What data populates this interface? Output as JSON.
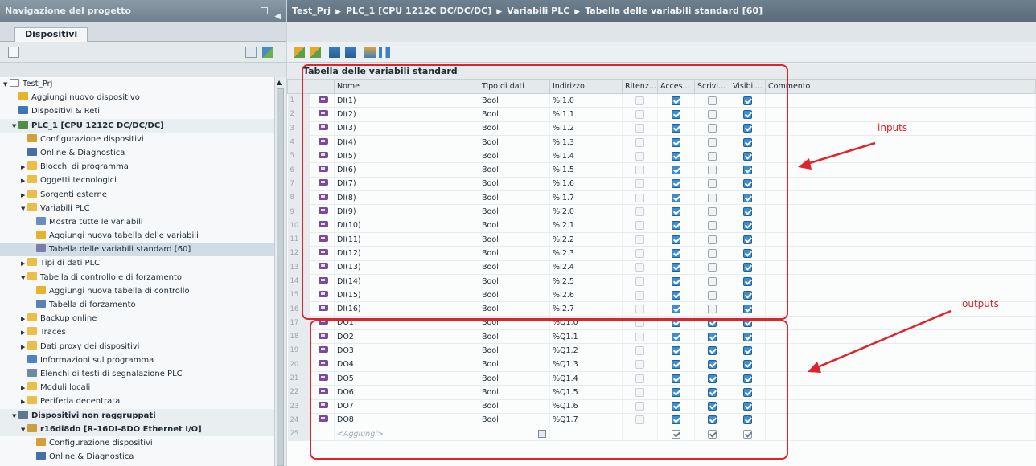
{
  "left_panel": {
    "title": "Navigazione del progetto",
    "tab": "Dispositivi",
    "tree": [
      {
        "label": "Test_Prj",
        "level": 0,
        "expand": "open",
        "icon": "project-icon"
      },
      {
        "label": "Aggiungi nuovo dispositivo",
        "level": 1,
        "expand": "none",
        "icon": "add-device-icon"
      },
      {
        "label": "Dispositivi & Reti",
        "level": 1,
        "expand": "none",
        "icon": "network-icon"
      },
      {
        "label": "PLC_1 [CPU 1212C DC/DC/DC]",
        "level": 1,
        "expand": "open",
        "icon": "plc-icon",
        "bold": true,
        "group": true
      },
      {
        "label": "Configurazione dispositivi",
        "level": 2,
        "expand": "none",
        "icon": "device-config-icon"
      },
      {
        "label": "Online & Diagnostica",
        "level": 2,
        "expand": "none",
        "icon": "diagnostics-icon"
      },
      {
        "label": "Blocchi di programma",
        "level": 2,
        "expand": "closed",
        "icon": "folder-icon"
      },
      {
        "label": "Oggetti tecnologici",
        "level": 2,
        "expand": "closed",
        "icon": "folder-icon"
      },
      {
        "label": "Sorgenti esterne",
        "level": 2,
        "expand": "closed",
        "icon": "folder-icon"
      },
      {
        "label": "Variabili PLC",
        "level": 2,
        "expand": "open",
        "icon": "folder-icon"
      },
      {
        "label": "Mostra tutte le variabili",
        "level": 3,
        "expand": "none",
        "icon": "tags-icon"
      },
      {
        "label": "Aggiungi nuova tabella delle variabili",
        "level": 3,
        "expand": "none",
        "icon": "add-table-icon"
      },
      {
        "label": "Tabella delle variabili standard [60]",
        "level": 3,
        "expand": "none",
        "icon": "tag-table-icon",
        "selected": true
      },
      {
        "label": "Tipi di dati PLC",
        "level": 2,
        "expand": "closed",
        "icon": "folder-icon"
      },
      {
        "label": "Tabella di controllo e di forzamento",
        "level": 2,
        "expand": "open",
        "icon": "folder-icon"
      },
      {
        "label": "Aggiungi nuova tabella di controllo",
        "level": 3,
        "expand": "none",
        "icon": "add-table-icon"
      },
      {
        "label": "Tabella di forzamento",
        "level": 3,
        "expand": "none",
        "icon": "force-table-icon"
      },
      {
        "label": "Backup online",
        "level": 2,
        "expand": "closed",
        "icon": "folder-icon"
      },
      {
        "label": "Traces",
        "level": 2,
        "expand": "closed",
        "icon": "folder-icon"
      },
      {
        "label": "Dati proxy dei dispositivi",
        "level": 2,
        "expand": "closed",
        "icon": "folder-icon"
      },
      {
        "label": "Informazioni sul programma",
        "level": 2,
        "expand": "none",
        "icon": "info-icon"
      },
      {
        "label": "Elenchi di testi di segnalazione PLC",
        "level": 2,
        "expand": "none",
        "icon": "text-list-icon"
      },
      {
        "label": "Moduli locali",
        "level": 2,
        "expand": "closed",
        "icon": "folder-icon"
      },
      {
        "label": "Periferia decentrata",
        "level": 2,
        "expand": "closed",
        "icon": "folder-icon"
      },
      {
        "label": "Dispositivi non raggruppati",
        "level": 1,
        "expand": "open",
        "icon": "ungrouped-icon",
        "bold": true,
        "group": true
      },
      {
        "label": "r16di8do [R-16DI-8DO Ethernet I/O]",
        "level": 2,
        "expand": "open",
        "icon": "io-device-icon",
        "bold": true,
        "group": true
      },
      {
        "label": "Configurazione dispositivi",
        "level": 3,
        "expand": "none",
        "icon": "device-config-icon"
      },
      {
        "label": "Online & Diagnostica",
        "level": 3,
        "expand": "none",
        "icon": "diagnostics-icon"
      }
    ]
  },
  "breadcrumb": [
    "Test_Prj",
    "PLC_1 [CPU 1212C DC/DC/DC]",
    "Variabili PLC",
    "Tabella delle variabili standard [60]"
  ],
  "table": {
    "title": "Tabella delle variabili standard",
    "columns": [
      "",
      "",
      "Nome",
      "Tipo di dati",
      "Indirizzo",
      "Ritenz...",
      "Acces...",
      "Scrivi...",
      "Visibil...",
      "Commento"
    ],
    "rows": [
      {
        "n": "1",
        "name": "DI(1)",
        "type": "Bool",
        "addr": "%I1.0",
        "ret": false,
        "acc": true,
        "wr": false,
        "vis": true
      },
      {
        "n": "2",
        "name": "DI(2)",
        "type": "Bool",
        "addr": "%I1.1",
        "ret": false,
        "acc": true,
        "wr": false,
        "vis": true
      },
      {
        "n": "3",
        "name": "DI(3)",
        "type": "Bool",
        "addr": "%I1.2",
        "ret": false,
        "acc": true,
        "wr": false,
        "vis": true
      },
      {
        "n": "4",
        "name": "DI(4)",
        "type": "Bool",
        "addr": "%I1.3",
        "ret": false,
        "acc": true,
        "wr": false,
        "vis": true
      },
      {
        "n": "5",
        "name": "DI(5)",
        "type": "Bool",
        "addr": "%I1.4",
        "ret": false,
        "acc": true,
        "wr": false,
        "vis": true
      },
      {
        "n": "6",
        "name": "DI(6)",
        "type": "Bool",
        "addr": "%I1.5",
        "ret": false,
        "acc": true,
        "wr": false,
        "vis": true
      },
      {
        "n": "7",
        "name": "DI(7)",
        "type": "Bool",
        "addr": "%I1.6",
        "ret": false,
        "acc": true,
        "wr": false,
        "vis": true
      },
      {
        "n": "8",
        "name": "DI(8)",
        "type": "Bool",
        "addr": "%I1.7",
        "ret": false,
        "acc": true,
        "wr": false,
        "vis": true
      },
      {
        "n": "9",
        "name": "DI(9)",
        "type": "Bool",
        "addr": "%I2.0",
        "ret": false,
        "acc": true,
        "wr": false,
        "vis": true
      },
      {
        "n": "10",
        "name": "DI(10)",
        "type": "Bool",
        "addr": "%I2.1",
        "ret": false,
        "acc": true,
        "wr": false,
        "vis": true
      },
      {
        "n": "11",
        "name": "DI(11)",
        "type": "Bool",
        "addr": "%I2.2",
        "ret": false,
        "acc": true,
        "wr": false,
        "vis": true
      },
      {
        "n": "12",
        "name": "DI(12)",
        "type": "Bool",
        "addr": "%I2.3",
        "ret": false,
        "acc": true,
        "wr": false,
        "vis": true
      },
      {
        "n": "13",
        "name": "DI(13)",
        "type": "Bool",
        "addr": "%I2.4",
        "ret": false,
        "acc": true,
        "wr": false,
        "vis": true
      },
      {
        "n": "14",
        "name": "DI(14)",
        "type": "Bool",
        "addr": "%I2.5",
        "ret": false,
        "acc": true,
        "wr": false,
        "vis": true
      },
      {
        "n": "15",
        "name": "DI(15)",
        "type": "Bool",
        "addr": "%I2.6",
        "ret": false,
        "acc": true,
        "wr": false,
        "vis": true
      },
      {
        "n": "16",
        "name": "DI(16)",
        "type": "Bool",
        "addr": "%I2.7",
        "ret": false,
        "acc": true,
        "wr": false,
        "vis": true
      },
      {
        "n": "17",
        "name": "DO1",
        "type": "Bool",
        "addr": "%Q1.0",
        "ret": false,
        "acc": true,
        "wr": true,
        "vis": true
      },
      {
        "n": "18",
        "name": "DO2",
        "type": "Bool",
        "addr": "%Q1.1",
        "ret": false,
        "acc": true,
        "wr": true,
        "vis": true
      },
      {
        "n": "19",
        "name": "DO3",
        "type": "Bool",
        "addr": "%Q1.2",
        "ret": false,
        "acc": true,
        "wr": true,
        "vis": true
      },
      {
        "n": "20",
        "name": "DO4",
        "type": "Bool",
        "addr": "%Q1.3",
        "ret": false,
        "acc": true,
        "wr": true,
        "vis": true
      },
      {
        "n": "21",
        "name": "DO5",
        "type": "Bool",
        "addr": "%Q1.4",
        "ret": false,
        "acc": true,
        "wr": true,
        "vis": true
      },
      {
        "n": "22",
        "name": "DO6",
        "type": "Bool",
        "addr": "%Q1.5",
        "ret": false,
        "acc": true,
        "wr": true,
        "vis": true
      },
      {
        "n": "23",
        "name": "DO7",
        "type": "Bool",
        "addr": "%Q1.6",
        "ret": false,
        "acc": true,
        "wr": true,
        "vis": true
      },
      {
        "n": "24",
        "name": "DO8",
        "type": "Bool",
        "addr": "%Q1.7",
        "ret": false,
        "acc": true,
        "wr": true,
        "vis": true
      }
    ],
    "add_row": {
      "n": "25",
      "placeholder": "<Aggiungi>"
    }
  },
  "annotations": {
    "inputs_label": "inputs",
    "outputs_label": "outputs",
    "color": "#e0222a"
  },
  "colors": {
    "accent_check": "#3c8ed0",
    "tag_icon": "#7b4a9b",
    "selection": "#d1dde6"
  }
}
